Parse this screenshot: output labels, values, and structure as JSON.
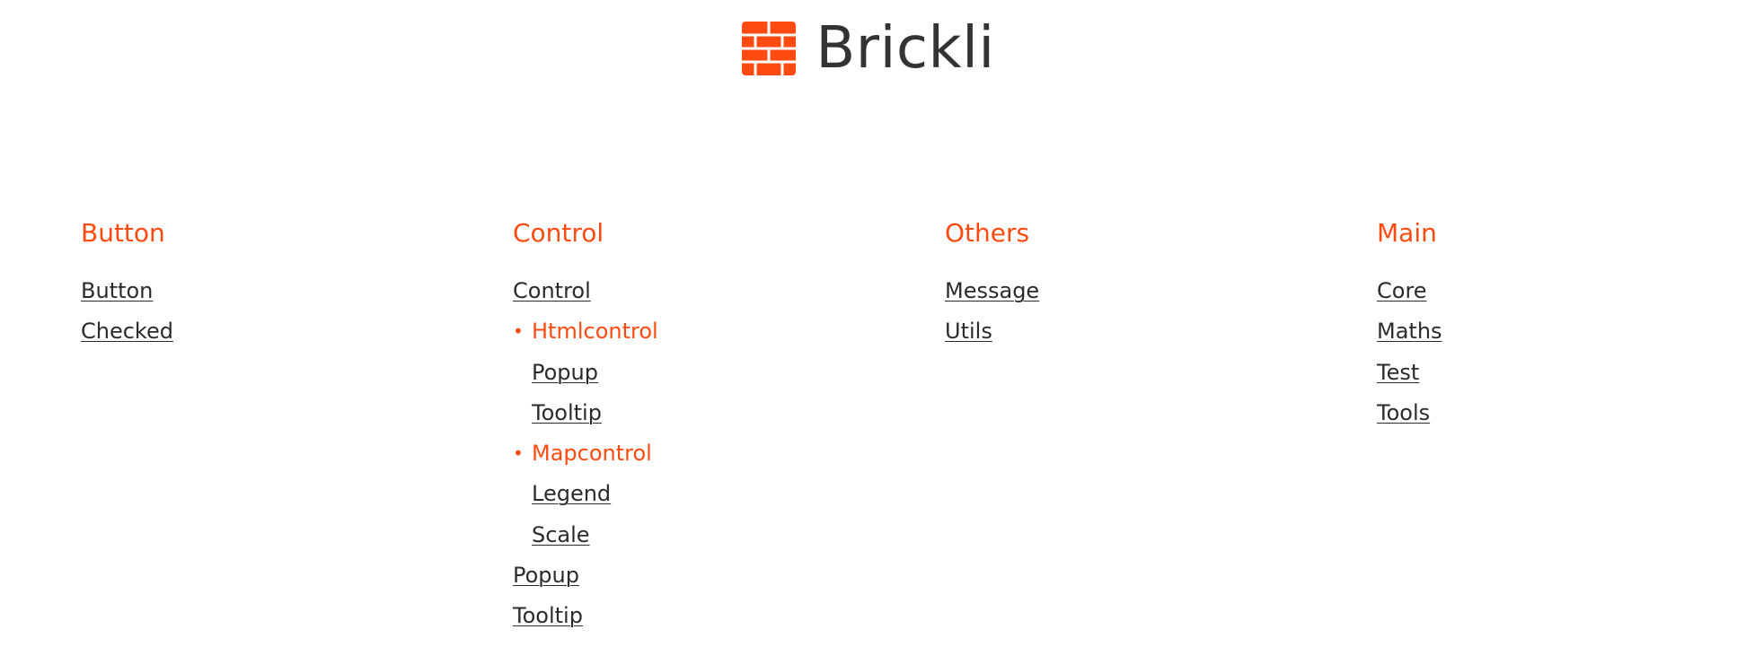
{
  "brand": {
    "name": "Brickli",
    "icon": "brick-wall-icon",
    "accent_color": "#ff4b12"
  },
  "columns": [
    {
      "title": "Button",
      "items": [
        {
          "label": "Button",
          "kind": "link"
        },
        {
          "label": "Checked",
          "kind": "link"
        }
      ]
    },
    {
      "title": "Control",
      "items": [
        {
          "label": "Control",
          "kind": "link"
        },
        {
          "label": "Htmlcontrol",
          "kind": "group"
        },
        {
          "label": "Popup",
          "kind": "sub"
        },
        {
          "label": "Tooltip",
          "kind": "sub"
        },
        {
          "label": "Mapcontrol",
          "kind": "group"
        },
        {
          "label": "Legend",
          "kind": "sub"
        },
        {
          "label": "Scale",
          "kind": "sub"
        },
        {
          "label": "Popup",
          "kind": "link"
        },
        {
          "label": "Tooltip",
          "kind": "link"
        }
      ]
    },
    {
      "title": "Others",
      "items": [
        {
          "label": "Message",
          "kind": "link"
        },
        {
          "label": "Utils",
          "kind": "link"
        }
      ]
    },
    {
      "title": "Main",
      "items": [
        {
          "label": "Core",
          "kind": "link"
        },
        {
          "label": "Maths",
          "kind": "link"
        },
        {
          "label": "Test",
          "kind": "link"
        },
        {
          "label": "Tools",
          "kind": "link"
        }
      ]
    }
  ]
}
